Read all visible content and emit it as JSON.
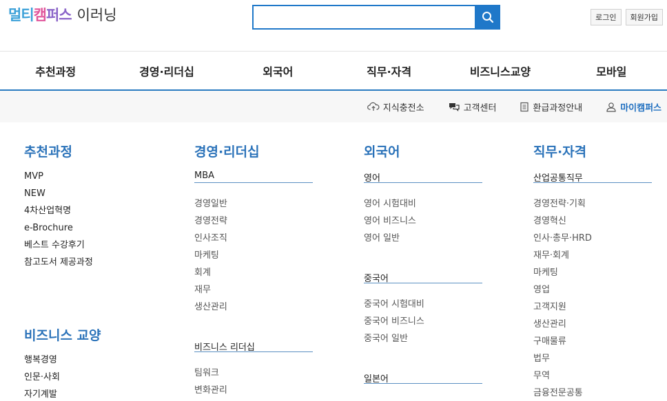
{
  "header": {
    "logo": {
      "part1": "멀티",
      "part2": "캠",
      "part3": "퍼스",
      "suffix": "이러닝"
    },
    "search": {
      "value": "",
      "placeholder": ""
    },
    "login_label": "로그인",
    "signup_label": "회원가입"
  },
  "gnb": [
    "추천과정",
    "경영·리더십",
    "외국어",
    "직무·자격",
    "비즈니스교양",
    "모바일"
  ],
  "quicklinks": {
    "knowledge": "지식충전소",
    "support": "고객센터",
    "refund": "환급과정안내",
    "mycampus": "마이캠퍼스"
  },
  "mega": {
    "recommended": {
      "title": "추천과정",
      "items": [
        "MVP",
        "NEW",
        "4차산업혁명",
        "e-Brochure",
        "베스트 수강후기",
        "참고도서 제공과정"
      ]
    },
    "business_culture": {
      "title": "비즈니스 교양",
      "items": [
        "행복경영",
        "인문·사회",
        "자기계발"
      ]
    },
    "management": {
      "title": "경영·리더십",
      "groups": [
        {
          "heading": "MBA",
          "items": [
            "경영일반",
            "경영전략",
            "인사조직",
            "마케팅",
            "회계",
            "재무",
            "생산관리"
          ]
        },
        {
          "heading": "비즈니스 리더십",
          "items": [
            "팀워크",
            "변화관리"
          ]
        }
      ]
    },
    "language": {
      "title": "외국어",
      "groups": [
        {
          "heading": "영어",
          "items": [
            "영어 시험대비",
            "영어 비즈니스",
            "영어 일반"
          ]
        },
        {
          "heading": "중국어",
          "items": [
            "중국어 시험대비",
            "중국어 비즈니스",
            "중국어 일반"
          ]
        },
        {
          "heading": "일본어",
          "items": []
        }
      ]
    },
    "job": {
      "title": "직무·자격",
      "groups": [
        {
          "heading": "산업공통직무",
          "items": [
            "경영전략·기획",
            "경영혁신",
            "인사·총무·HRD",
            "재무·회계",
            "마케팅",
            "영업",
            "고객지원",
            "생산관리",
            "구매물류",
            "법무",
            "무역",
            "금융전문공통"
          ]
        }
      ]
    }
  }
}
